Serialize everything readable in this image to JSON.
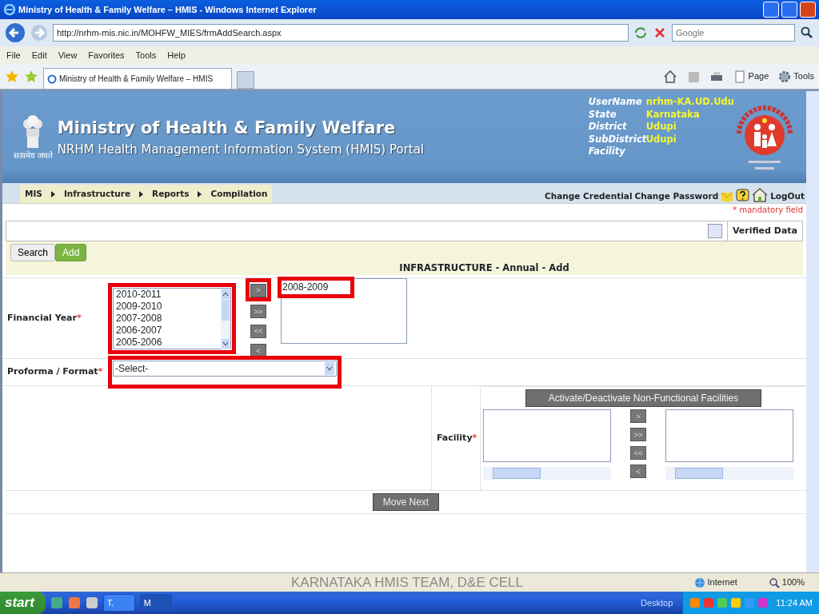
{
  "window": {
    "title": "Ministry of Health & Family Welfare – HMIS - Windows Internet Explorer"
  },
  "address_bar": {
    "url": "http://nrhm-mis.nic.in/MOHFW_MIES/frmAddSearch.aspx"
  },
  "search_box": {
    "placeholder": "Google"
  },
  "menu": [
    "File",
    "Edit",
    "View",
    "Favorites",
    "Tools",
    "Help"
  ],
  "browser_tabs": [
    {
      "label": "Ministry of Health & Family Welfare – HMIS",
      "selected": true
    }
  ],
  "command_bar": [
    "Page",
    "Tools"
  ],
  "header": {
    "title": "Ministry of Health & Family Welfare",
    "subtitle": "NRHM Health Management Information System (HMIS) Portal",
    "emblem_caption": "सत्यमेव जयते",
    "user_info": [
      {
        "label": "UserName",
        "value": "nrhm-KA.UD.Udu"
      },
      {
        "label": "State",
        "value": "Karnataka"
      },
      {
        "label": "District",
        "value": "Udupi"
      },
      {
        "label": "SubDistrict",
        "value": "Udupi"
      },
      {
        "label": "Facility"
      }
    ]
  },
  "nav": [
    "MIS",
    "Infrastructure",
    "Reports",
    "Compilation"
  ],
  "user_links": [
    "Change Credential",
    "Change Password",
    "LogOut"
  ],
  "mandatory_note": "* mandatory field",
  "verified_legend": "Verified Data",
  "action_tabs": [
    {
      "label": "Search",
      "selected": false
    },
    {
      "label": "Add",
      "selected": true
    }
  ],
  "form_title": "INFRASTRUCTURE - Annual - Add",
  "financial_year": {
    "label": "Financial Year",
    "required_mark": "*",
    "highlighted": true,
    "available": [
      "2010-2011",
      "2009-2010",
      "2007-2008",
      "2006-2007",
      "2005-2006"
    ],
    "chosen": [
      "2008-2009"
    ],
    "move_buttons": [
      {
        "label": ">",
        "highlighted": true
      },
      {
        "label": ">>",
        "highlighted": false
      },
      {
        "label": "<<",
        "highlighted": false
      },
      {
        "label": "<",
        "highlighted": false
      }
    ]
  },
  "proforma": {
    "label": "Proforma / Format",
    "required_mark": "*",
    "value": "-Select-",
    "highlighted": true
  },
  "facility": {
    "label": "Facility",
    "required_mark": "*",
    "toggle_button": "Activate/Deactivate Non-Functional Facilities",
    "move_buttons": [
      ">",
      ">>",
      "<<",
      "<"
    ]
  },
  "move_next": "Move Next",
  "status_bar": {
    "zone": "Internet",
    "zoom": "100%"
  },
  "footer_caption": "KARNATAKA HMIS TEAM, D&E CELL",
  "taskbar": {
    "start": "start",
    "buttons": [
      {
        "label": "T.",
        "selected": false
      },
      {
        "label": "M",
        "selected": true
      }
    ],
    "desktop": "Desktop",
    "time": "11:24 AM"
  }
}
